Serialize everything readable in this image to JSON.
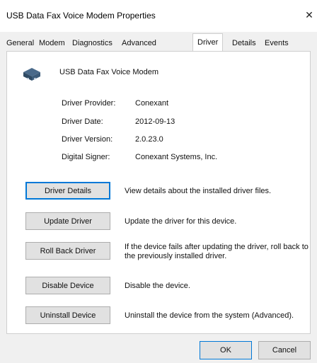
{
  "window": {
    "title": "USB Data Fax Voice Modem Properties",
    "close_label": "✕"
  },
  "tabs": [
    {
      "label": "General"
    },
    {
      "label": "Modem"
    },
    {
      "label": "Diagnostics"
    },
    {
      "label": "Advanced"
    },
    {
      "label": "Driver",
      "active": true
    },
    {
      "label": "Details"
    },
    {
      "label": "Events"
    }
  ],
  "device": {
    "name": "USB Data Fax Voice Modem",
    "icon": "modem-device-icon"
  },
  "driver_info": [
    {
      "label": "Driver Provider:",
      "value": "Conexant"
    },
    {
      "label": "Driver Date:",
      "value": "2012-09-13"
    },
    {
      "label": "Driver Version:",
      "value": "2.0.23.0"
    },
    {
      "label": "Digital Signer:",
      "value": "Conexant Systems, Inc."
    }
  ],
  "actions": [
    {
      "button": "Driver Details",
      "description": "View details about the installed driver files."
    },
    {
      "button": "Update Driver",
      "description": "Update the driver for this device."
    },
    {
      "button": "Roll Back Driver",
      "description": "If the device fails after updating the driver, roll back to the previously installed driver."
    },
    {
      "button": "Disable Device",
      "description": "Disable the device."
    },
    {
      "button": "Uninstall Device",
      "description": "Uninstall the device from the system (Advanced)."
    }
  ],
  "footer": {
    "ok_label": "OK",
    "cancel_label": "Cancel"
  },
  "colors": {
    "focus_border": "#0078d7",
    "button_face": "#e1e1e1",
    "dialog_bg": "#f0f0f0"
  }
}
